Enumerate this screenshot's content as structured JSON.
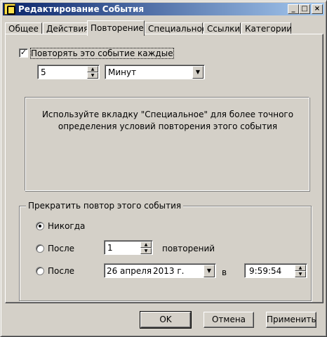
{
  "window": {
    "title": "Редактирование События",
    "buttons": {
      "minimize": "_",
      "maximize": "□",
      "close": "×"
    }
  },
  "tabs": [
    "Общее",
    "Действия",
    "Повторение",
    "Специальное",
    "Ссылки",
    "Категории"
  ],
  "active_tab": "Повторение",
  "repeat": {
    "checkbox_label": "Повторять это событие каждые",
    "checked": true,
    "interval_value": "5",
    "unit_value": "Минут"
  },
  "info": {
    "line1": "Используйте вкладку \"Специальное\" для более точного",
    "line2": "определения условий повторения этого события"
  },
  "stop_group": {
    "legend": "Прекратить повтор этого события",
    "never_label": "Никогда",
    "never_selected": true,
    "after_label": "После",
    "after_count": "1",
    "after_suffix": "повторений",
    "after_date_label": "После",
    "date_day": "26",
    "date_month": "апреля",
    "date_year": "2013 г.",
    "at_label": "в",
    "time_value": "9:59:54"
  },
  "buttons": {
    "ok": "OK",
    "cancel": "Отмена",
    "apply": "Применить"
  },
  "colors": {
    "face": "#d4d0c8",
    "title_start": "#0a246a",
    "title_end": "#a6caf0"
  },
  "icons": {
    "app": "bug-icon",
    "check": "checkmark-icon",
    "spin_up": "spin-up-icon",
    "spin_down": "spin-down-icon",
    "dropdown": "dropdown-arrow-icon"
  }
}
